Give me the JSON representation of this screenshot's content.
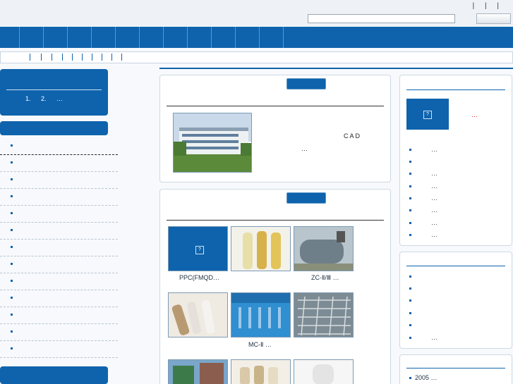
{
  "header": {
    "top_links": "| | |"
  },
  "left": {
    "steps": "1.  2.  …"
  },
  "about": {
    "cad": "CAD",
    "more": "…"
  },
  "products": {
    "captions": [
      "PPC(FMQD…",
      "ZC-Ⅱ/Ⅲ …",
      "MC-Ⅱ …"
    ],
    "placeholder_glyph": "?"
  },
  "right_top": {
    "placeholder_glyph": "?",
    "title_more": "…",
    "items": [
      "…",
      "",
      "…",
      "…",
      "…",
      "…",
      "…",
      "…"
    ]
  },
  "right_mid": {
    "items": [
      "",
      "",
      "",
      "",
      "",
      "…"
    ]
  },
  "right_bottom": {
    "items": [
      "2005 …"
    ]
  },
  "colors": {
    "brand_blue": "#0e63ac",
    "red": "#cc0000"
  },
  "icons": [
    "search-icon",
    "bullet-icon",
    "broken-image-icon"
  ]
}
